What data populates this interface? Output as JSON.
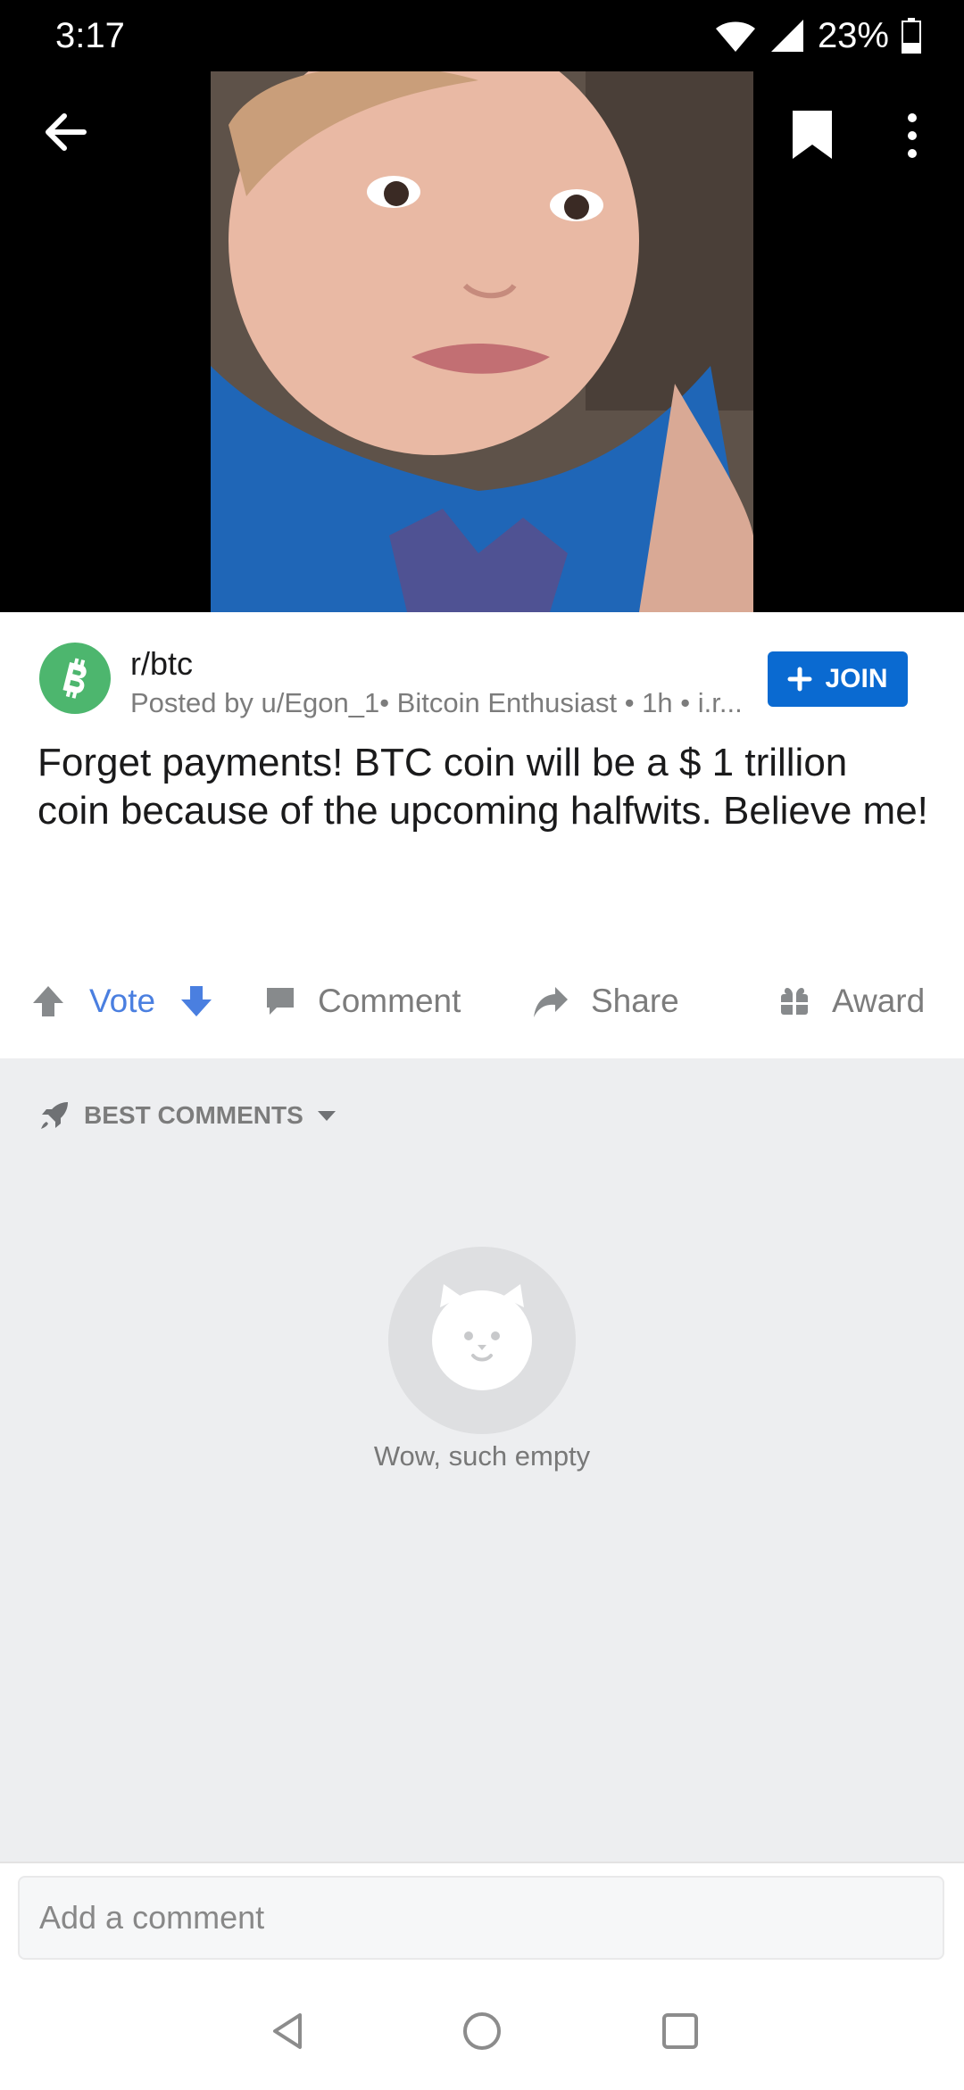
{
  "status_bar": {
    "time": "3:17",
    "battery": "23%"
  },
  "post": {
    "subreddit": "r/btc",
    "meta": "Posted by u/Egon_1• Bitcoin Enthusiast • 1h • i.r...",
    "title": "Forget payments! BTC coin will be a $ 1 trillion coin because of the upcoming halfwits. Believe me!",
    "join_label": "JOIN"
  },
  "actions": {
    "vote_label": "Vote",
    "comment_label": "Comment",
    "share_label": "Share",
    "award_label": "Award"
  },
  "comments": {
    "sort_label": "BEST COMMENTS",
    "empty_text": "Wow, such empty"
  },
  "comment_input": {
    "placeholder": "Add a comment"
  },
  "colors": {
    "accent_blue": "#0a6ad1",
    "vote_blue": "#4a7fe0",
    "subreddit_green": "#4db66e"
  }
}
